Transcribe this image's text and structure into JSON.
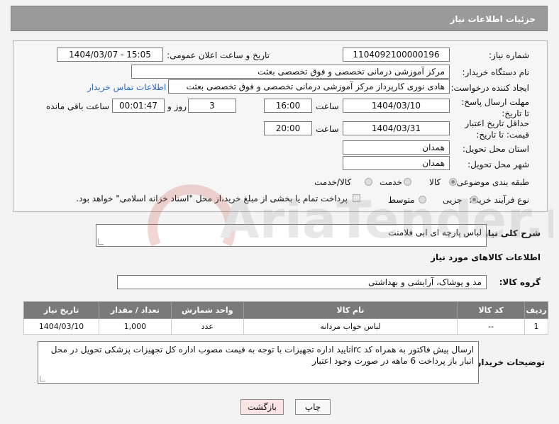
{
  "header": {
    "title": "جزئیات اطلاعات نیاز"
  },
  "form": {
    "need_number_label": "شماره نیاز:",
    "need_number": "1104092100000196",
    "announce_label": "تاریخ و ساعت اعلان عمومی:",
    "announce_value": "1404/03/07 - 15:05",
    "buyer_org_label": "نام دستگاه خریدار:",
    "buyer_org": "مرکز آموزشی درمانی تخصصی و فوق تخصصی بعثت",
    "requester_label": "ایجاد کننده درخواست:",
    "requester": "هادی نوری کارپرداز مرکز آموزشی درمانی تخصصی و فوق تخصصی بعثت",
    "contact_link": "اطلاعات تماس خریدار",
    "reply_deadline_label": "مهلت ارسال پاسخ: تا تاریخ:",
    "reply_date": "1404/03/10",
    "time_label": "ساعت",
    "reply_time": "16:00",
    "days_value": "3",
    "days_label": "روز و",
    "remaining_value": "00:01:47",
    "remaining_label": "ساعت باقی مانده",
    "price_validity_label": "حداقل تاریخ اعتبار قیمت: تا تاریخ:",
    "price_date": "1404/03/31",
    "price_time": "20:00",
    "province_label": "استان محل تحویل:",
    "province": "همدان",
    "city_label": "شهر محل تحویل:",
    "city": "همدان",
    "category_label": "طبقه بندی موضوعی:",
    "category_options": [
      "کالا",
      "خدمت",
      "کالا/خدمت"
    ],
    "purchase_type_label": "نوع فرآیند خرید :",
    "purchase_options": [
      "جزیی",
      "متوسط"
    ],
    "payment_note": "پرداخت تمام یا بخشی از مبلغ خرید،از محل \"اسناد خزانه اسلامی\" خواهد بود."
  },
  "description": {
    "label": "شرح کلی نیاز:",
    "value": "لباس پارچه ای ابی فلامنت"
  },
  "goods_section": {
    "title": "اطلاعات کالاهای مورد نیاز",
    "group_label": "گروه کالا:",
    "group_value": "مد و پوشاک، آرایشی و بهداشتی"
  },
  "table": {
    "headers": [
      "ردیف",
      "کد کالا",
      "نام کالا",
      "واحد شمارش",
      "تعداد / مقدار",
      "تاریخ نیاز"
    ],
    "rows": [
      [
        "1",
        "--",
        "لباس خواب مردانه",
        "عدد",
        "1,000",
        "1404/03/10"
      ]
    ]
  },
  "buyer_notes": {
    "label": "توضیحات خریدار:",
    "value": "ارسال پیش فاکتور به همراه کد ircتایید اداره تجهیزات  با توجه به قیمت مصوب اداره کل تجهیزات پزشکی تحویل در محل انبار باز پرداخت 6 ماهه در صورت وجود اعتبار"
  },
  "buttons": {
    "print": "چاپ",
    "back": "بازگشت"
  },
  "watermark": {
    "text": "AriaTender.net"
  },
  "colors": {
    "header_bg": "#9a9a9a",
    "link": "#2a6cc9",
    "table_header": "#7a7a7a",
    "back_button": "#fde4e4"
  }
}
